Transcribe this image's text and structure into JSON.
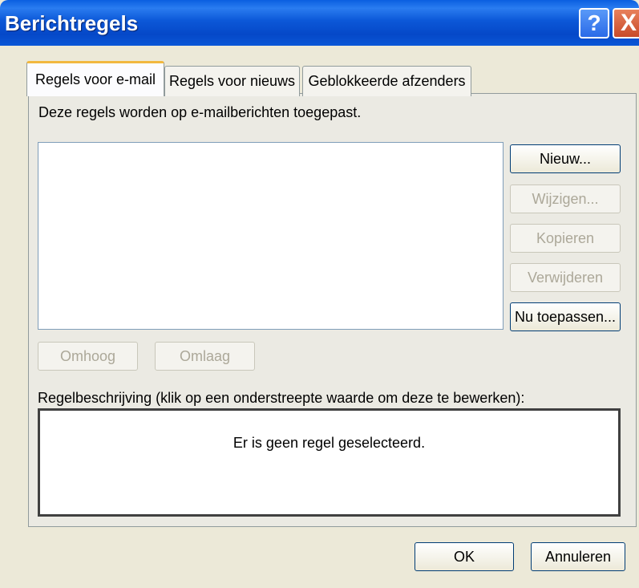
{
  "window": {
    "title": "Berichtregels"
  },
  "titlebar_buttons": {
    "help": "?",
    "close": "X"
  },
  "tabs": [
    {
      "label": "Regels voor e-mail",
      "active": true
    },
    {
      "label": "Regels voor nieuws",
      "active": false
    },
    {
      "label": "Geblokkeerde afzenders",
      "active": false
    }
  ],
  "intro_text": "Deze regels worden op e-mailberichten toegepast.",
  "side_buttons": {
    "new": "Nieuw...",
    "edit": "Wijzigen...",
    "copy": "Kopieren",
    "delete": "Verwijderen",
    "apply_now": "Nu toepassen..."
  },
  "move_buttons": {
    "up": "Omhoog",
    "down": "Omlaag"
  },
  "description": {
    "label": "Regelbeschrijving (klik op een onderstreepte waarde om deze te bewerken):",
    "empty_text": "Er is geen regel geselecteerd."
  },
  "dialog_buttons": {
    "ok": "OK",
    "cancel": "Annuleren"
  }
}
